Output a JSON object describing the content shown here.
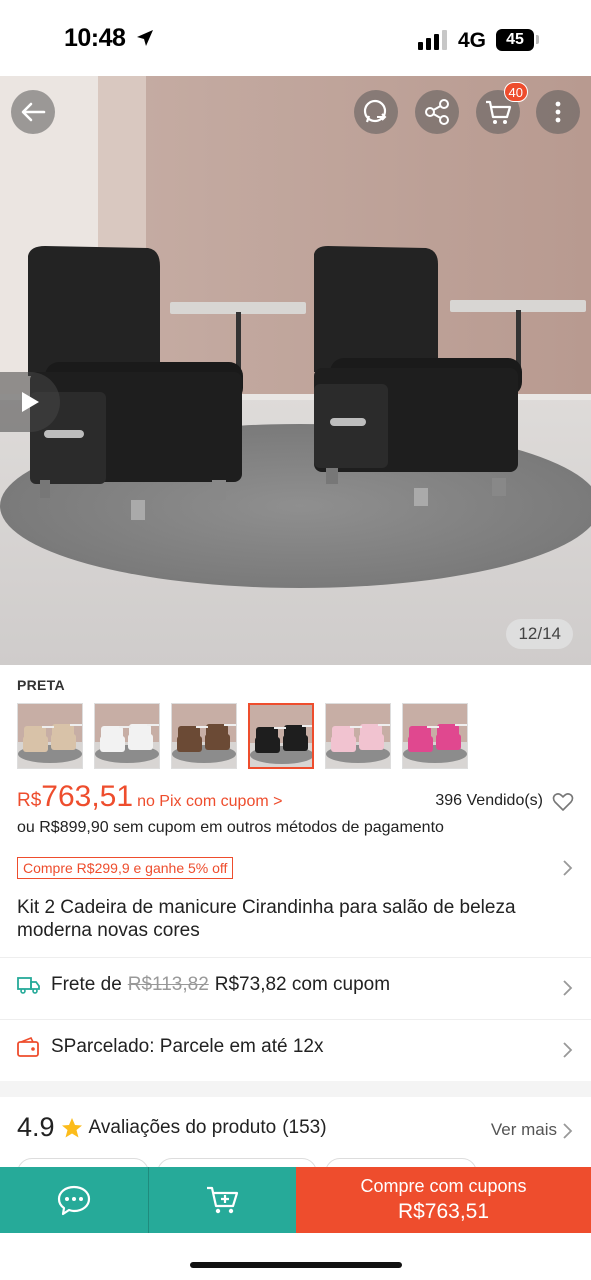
{
  "status_bar": {
    "time": "10:48",
    "network": "4G",
    "battery": "45"
  },
  "hero": {
    "image_counter": "12/14",
    "cart_count": "40"
  },
  "variant": {
    "label": "PRETA",
    "options": [
      {
        "name": "bege",
        "color": "#d8c2a8"
      },
      {
        "name": "branca",
        "color": "#f2f2f2"
      },
      {
        "name": "marrom",
        "color": "#6b4a35"
      },
      {
        "name": "preta",
        "color": "#1e1e1e",
        "selected": true
      },
      {
        "name": "rosa-claro",
        "color": "#f1c3d0"
      },
      {
        "name": "pink",
        "color": "#e0488f"
      }
    ]
  },
  "price": {
    "currency": "R$",
    "value": "763,51",
    "pix_text": "no Pix com cupom >",
    "sold": "396 Vendido(s)",
    "alt_text": "ou R$899,90 sem cupom em outros métodos de pagamento"
  },
  "promo": {
    "label": "Compre R$299,9 e ganhe 5% off"
  },
  "product": {
    "title": "Kit 2 Cadeira de manicure Cirandinha para salão de beleza moderna novas cores"
  },
  "shipping": {
    "prefix": "Frete de",
    "old_price": "R$113,82",
    "new_price": "R$73,82 com cupom"
  },
  "installment": {
    "label": "SParcelado: Parcele em até 12x"
  },
  "reviews": {
    "score": "4.9",
    "label": "Avaliações do produto",
    "count": "(153)",
    "see_more": "Ver mais"
  },
  "bottom_bar": {
    "buy_line1": "Compre com cupons",
    "buy_line2": "R$763,51"
  },
  "colors": {
    "accent": "#ee4d2d",
    "teal": "#26aa99"
  }
}
